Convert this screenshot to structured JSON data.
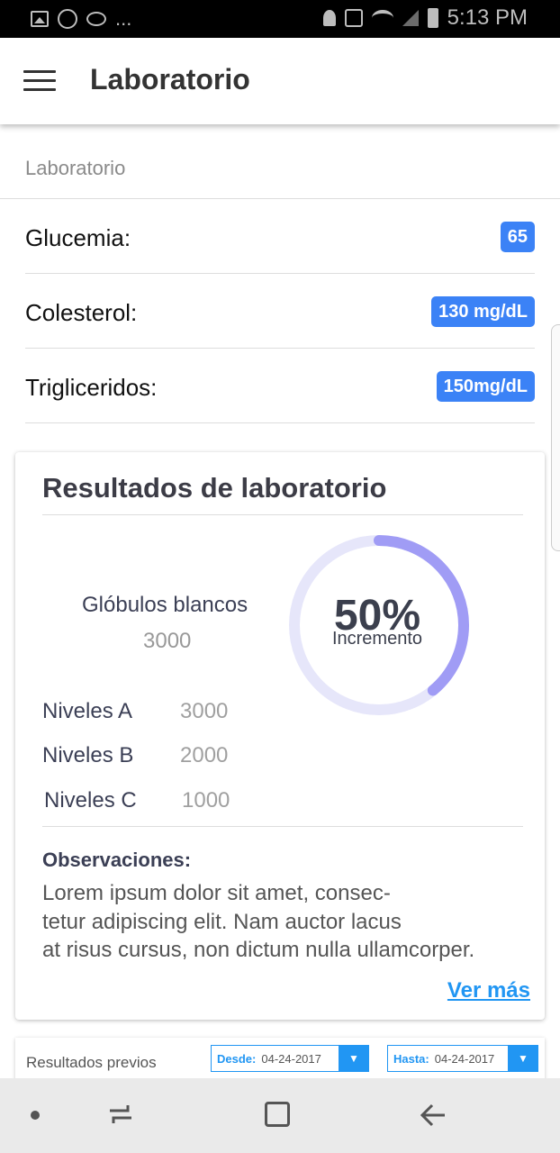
{
  "status_bar": {
    "time": "5:13 PM",
    "left_icons": [
      "image-icon",
      "whatsapp-icon",
      "eye-icon",
      "more-notifications"
    ],
    "more_label": "...",
    "right_icons": [
      "alarm-icon",
      "mute-icon",
      "wifi-icon",
      "signal-icon",
      "battery-icon"
    ]
  },
  "app_bar": {
    "title": "Laboratorio",
    "menu_icon": "hamburger-menu-icon"
  },
  "section": {
    "header": "Laboratorio"
  },
  "lab_items": [
    {
      "label": "Glucemia:",
      "value": "65"
    },
    {
      "label": "Colesterol:",
      "value": "130 mg/dL"
    },
    {
      "label": "Trigliceridos:",
      "value": "150mg/dL"
    }
  ],
  "results_card": {
    "title": "Resultados de laboratorio",
    "wbc_label": "Glóbulos blancos",
    "wbc_value": "3000",
    "gauge": {
      "percent_text": "50%",
      "caption": "Incremento",
      "fill_fraction": 0.5,
      "track_color": "#e6e6fa",
      "fill_color": "#a09cf5"
    },
    "levels": [
      {
        "name": "Niveles  A",
        "value": "3000"
      },
      {
        "name": "Niveles  B",
        "value": "2000"
      },
      {
        "name": "Niveles  C",
        "value": "1000"
      }
    ],
    "observations_title": "Observaciones:",
    "observations_lines": [
      "Lorem ipsum dolor sit amet, consec-",
      "tetur adipiscing elit. Nam auctor lacus",
      "at risus cursus, non dictum nulla ullamcorper."
    ],
    "more_link": "Ver más"
  },
  "previous": {
    "label": "Resultados previos",
    "from_label": "Desde:",
    "from_value": "04-24-2017",
    "to_label": "Hasta:",
    "to_value": "04-24-2017",
    "dropdown_icon": "chevron-down-icon"
  },
  "nav_bar": {
    "icons": [
      "dot-icon",
      "recent-apps-icon",
      "home-icon",
      "back-icon"
    ]
  },
  "colors": {
    "badge": "#3b82f6",
    "link": "#2196f3",
    "status_bar_bg": "#000000",
    "nav_bar_bg": "#eaeaea"
  }
}
